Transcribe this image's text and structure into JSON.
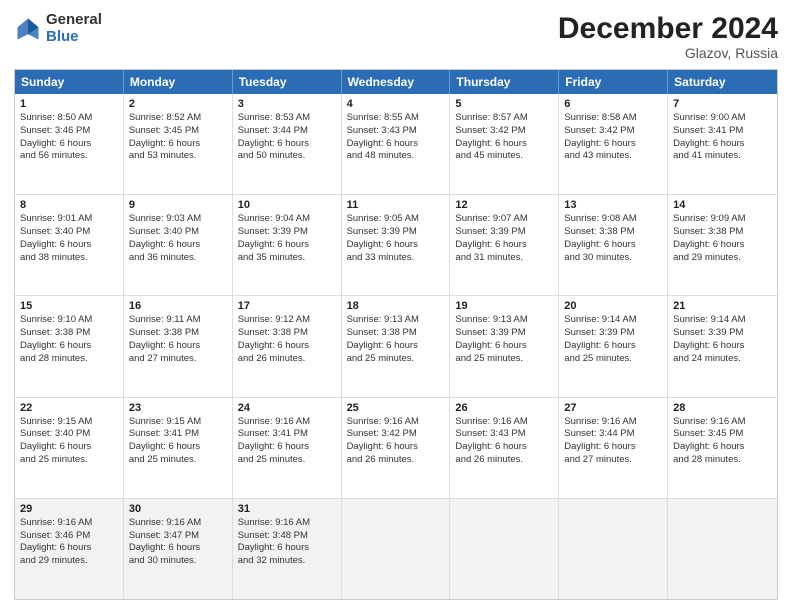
{
  "logo": {
    "general": "General",
    "blue": "Blue"
  },
  "title": "December 2024",
  "location": "Glazov, Russia",
  "header_days": [
    "Sunday",
    "Monday",
    "Tuesday",
    "Wednesday",
    "Thursday",
    "Friday",
    "Saturday"
  ],
  "weeks": [
    [
      {
        "day": "1",
        "lines": [
          "Sunrise: 8:50 AM",
          "Sunset: 3:46 PM",
          "Daylight: 6 hours",
          "and 56 minutes."
        ]
      },
      {
        "day": "2",
        "lines": [
          "Sunrise: 8:52 AM",
          "Sunset: 3:45 PM",
          "Daylight: 6 hours",
          "and 53 minutes."
        ]
      },
      {
        "day": "3",
        "lines": [
          "Sunrise: 8:53 AM",
          "Sunset: 3:44 PM",
          "Daylight: 6 hours",
          "and 50 minutes."
        ]
      },
      {
        "day": "4",
        "lines": [
          "Sunrise: 8:55 AM",
          "Sunset: 3:43 PM",
          "Daylight: 6 hours",
          "and 48 minutes."
        ]
      },
      {
        "day": "5",
        "lines": [
          "Sunrise: 8:57 AM",
          "Sunset: 3:42 PM",
          "Daylight: 6 hours",
          "and 45 minutes."
        ]
      },
      {
        "day": "6",
        "lines": [
          "Sunrise: 8:58 AM",
          "Sunset: 3:42 PM",
          "Daylight: 6 hours",
          "and 43 minutes."
        ]
      },
      {
        "day": "7",
        "lines": [
          "Sunrise: 9:00 AM",
          "Sunset: 3:41 PM",
          "Daylight: 6 hours",
          "and 41 minutes."
        ]
      }
    ],
    [
      {
        "day": "8",
        "lines": [
          "Sunrise: 9:01 AM",
          "Sunset: 3:40 PM",
          "Daylight: 6 hours",
          "and 38 minutes."
        ]
      },
      {
        "day": "9",
        "lines": [
          "Sunrise: 9:03 AM",
          "Sunset: 3:40 PM",
          "Daylight: 6 hours",
          "and 36 minutes."
        ]
      },
      {
        "day": "10",
        "lines": [
          "Sunrise: 9:04 AM",
          "Sunset: 3:39 PM",
          "Daylight: 6 hours",
          "and 35 minutes."
        ]
      },
      {
        "day": "11",
        "lines": [
          "Sunrise: 9:05 AM",
          "Sunset: 3:39 PM",
          "Daylight: 6 hours",
          "and 33 minutes."
        ]
      },
      {
        "day": "12",
        "lines": [
          "Sunrise: 9:07 AM",
          "Sunset: 3:39 PM",
          "Daylight: 6 hours",
          "and 31 minutes."
        ]
      },
      {
        "day": "13",
        "lines": [
          "Sunrise: 9:08 AM",
          "Sunset: 3:38 PM",
          "Daylight: 6 hours",
          "and 30 minutes."
        ]
      },
      {
        "day": "14",
        "lines": [
          "Sunrise: 9:09 AM",
          "Sunset: 3:38 PM",
          "Daylight: 6 hours",
          "and 29 minutes."
        ]
      }
    ],
    [
      {
        "day": "15",
        "lines": [
          "Sunrise: 9:10 AM",
          "Sunset: 3:38 PM",
          "Daylight: 6 hours",
          "and 28 minutes."
        ]
      },
      {
        "day": "16",
        "lines": [
          "Sunrise: 9:11 AM",
          "Sunset: 3:38 PM",
          "Daylight: 6 hours",
          "and 27 minutes."
        ]
      },
      {
        "day": "17",
        "lines": [
          "Sunrise: 9:12 AM",
          "Sunset: 3:38 PM",
          "Daylight: 6 hours",
          "and 26 minutes."
        ]
      },
      {
        "day": "18",
        "lines": [
          "Sunrise: 9:13 AM",
          "Sunset: 3:38 PM",
          "Daylight: 6 hours",
          "and 25 minutes."
        ]
      },
      {
        "day": "19",
        "lines": [
          "Sunrise: 9:13 AM",
          "Sunset: 3:39 PM",
          "Daylight: 6 hours",
          "and 25 minutes."
        ]
      },
      {
        "day": "20",
        "lines": [
          "Sunrise: 9:14 AM",
          "Sunset: 3:39 PM",
          "Daylight: 6 hours",
          "and 25 minutes."
        ]
      },
      {
        "day": "21",
        "lines": [
          "Sunrise: 9:14 AM",
          "Sunset: 3:39 PM",
          "Daylight: 6 hours",
          "and 24 minutes."
        ]
      }
    ],
    [
      {
        "day": "22",
        "lines": [
          "Sunrise: 9:15 AM",
          "Sunset: 3:40 PM",
          "Daylight: 6 hours",
          "and 25 minutes."
        ]
      },
      {
        "day": "23",
        "lines": [
          "Sunrise: 9:15 AM",
          "Sunset: 3:41 PM",
          "Daylight: 6 hours",
          "and 25 minutes."
        ]
      },
      {
        "day": "24",
        "lines": [
          "Sunrise: 9:16 AM",
          "Sunset: 3:41 PM",
          "Daylight: 6 hours",
          "and 25 minutes."
        ]
      },
      {
        "day": "25",
        "lines": [
          "Sunrise: 9:16 AM",
          "Sunset: 3:42 PM",
          "Daylight: 6 hours",
          "and 26 minutes."
        ]
      },
      {
        "day": "26",
        "lines": [
          "Sunrise: 9:16 AM",
          "Sunset: 3:43 PM",
          "Daylight: 6 hours",
          "and 26 minutes."
        ]
      },
      {
        "day": "27",
        "lines": [
          "Sunrise: 9:16 AM",
          "Sunset: 3:44 PM",
          "Daylight: 6 hours",
          "and 27 minutes."
        ]
      },
      {
        "day": "28",
        "lines": [
          "Sunrise: 9:16 AM",
          "Sunset: 3:45 PM",
          "Daylight: 6 hours",
          "and 28 minutes."
        ]
      }
    ],
    [
      {
        "day": "29",
        "lines": [
          "Sunrise: 9:16 AM",
          "Sunset: 3:46 PM",
          "Daylight: 6 hours",
          "and 29 minutes."
        ]
      },
      {
        "day": "30",
        "lines": [
          "Sunrise: 9:16 AM",
          "Sunset: 3:47 PM",
          "Daylight: 6 hours",
          "and 30 minutes."
        ]
      },
      {
        "day": "31",
        "lines": [
          "Sunrise: 9:16 AM",
          "Sunset: 3:48 PM",
          "Daylight: 6 hours",
          "and 32 minutes."
        ]
      },
      {
        "day": "",
        "lines": []
      },
      {
        "day": "",
        "lines": []
      },
      {
        "day": "",
        "lines": []
      },
      {
        "day": "",
        "lines": []
      }
    ]
  ]
}
